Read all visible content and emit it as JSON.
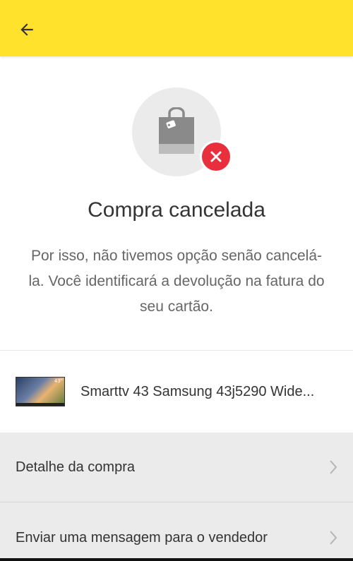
{
  "header": {
    "back_label": "Voltar",
    "background": "#ffe22b"
  },
  "status": {
    "title": "Compra cancelada",
    "message": "Por isso, não tivemos opção senão cancelá-la. Você identificará a devolução na fatura do seu cartão.",
    "icon": "shopping-bag-icon",
    "badge_icon": "close-icon",
    "badge_color": "#e8303d"
  },
  "product": {
    "name": "Smarttv 43 Samsung 43j5290 Wide...",
    "thumb_tag": "43\""
  },
  "actions": [
    {
      "label": "Detalhe da compra"
    },
    {
      "label": "Enviar uma mensagem para o vendedor"
    }
  ]
}
